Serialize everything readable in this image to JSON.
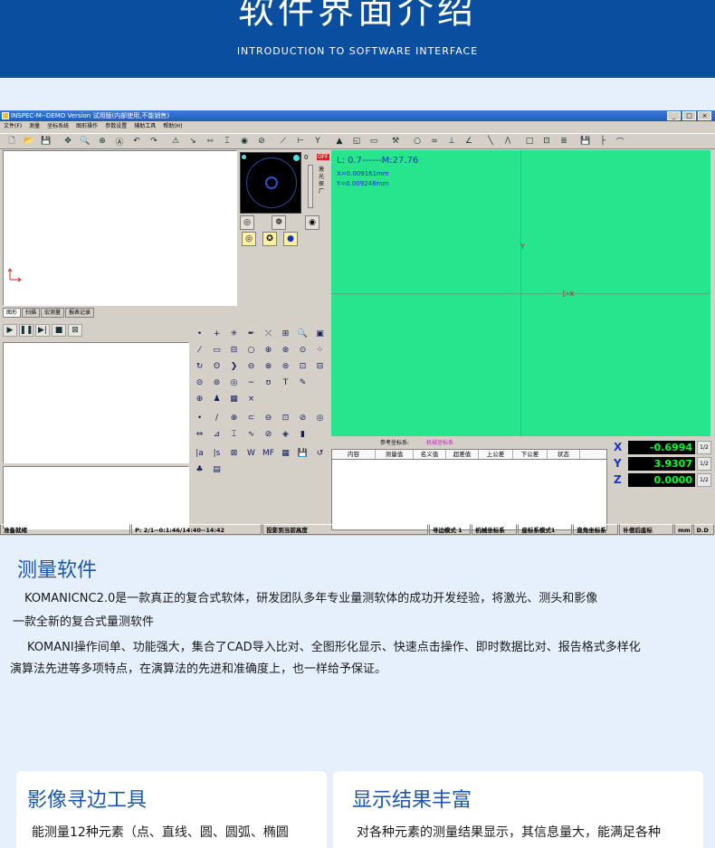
{
  "banner": {
    "title": "软件界面介绍",
    "subtitle": "INTRODUCTION TO SOFTWARE INTERFACE"
  },
  "window": {
    "title": "INSPEC-M--DEMO Version 试用版(内部使用,不能销售)",
    "controls": [
      "_",
      "□",
      "×"
    ],
    "menu": [
      "文件(F)",
      "测量",
      "坐标系统",
      "图形操作",
      "参数设置",
      "辅助工具",
      "帮助(H)"
    ]
  },
  "toolbar_icons": [
    "new-file-icon",
    "open-folder-icon",
    "save-icon",
    "sep",
    "move-icon",
    "zoom-window-icon",
    "zoom-fit-icon",
    "zoom-text-icon",
    "undo-icon",
    "redo-icon",
    "sep",
    "snap-icon",
    "measure-icon",
    "hdim-icon",
    "vdim-icon",
    "circle-dim-icon",
    "angle-dim-icon",
    "sep",
    "line-tool-icon",
    "width-icon",
    "y-tool-icon",
    "sep",
    "up-arrow-icon",
    "image-icon",
    "rect-icon",
    "sep",
    "tools-icon",
    "sep",
    "circle-icon",
    "equal-icon",
    "perp-icon",
    "angle-icon",
    "sep",
    "slash-icon",
    "lines-icon",
    "sep",
    "square-icon",
    "frame-icon",
    "list-icon",
    "sep",
    "save2-icon",
    "axis-icon",
    "arc-icon"
  ],
  "toolbar_glyphs": [
    "🗋",
    "📂",
    "💾",
    "",
    "✥",
    "🔍",
    "⊕",
    "Ⓐ",
    "↶",
    "↷",
    "",
    "⚠",
    "↘",
    "⇿",
    "⌶",
    "◉",
    "⊘",
    "",
    "⟋",
    "⊢",
    "Y",
    "",
    "▲",
    "◱",
    "▭",
    "",
    "⚒",
    "",
    "○",
    "=",
    "⊥",
    "∠",
    "",
    "╲",
    "/\\",
    "",
    "□",
    "⊡",
    "≣",
    "",
    "💾",
    "├",
    "⌒"
  ],
  "graph_tabs": [
    "图形",
    "扫描",
    "宏测量",
    "报表记录"
  ],
  "laser": {
    "zero": "0",
    "label": "激光探厂",
    "off": "OFF"
  },
  "control_icons": [
    "▶",
    "❚❚",
    "▶|",
    "■",
    "⊠"
  ],
  "tool_groups": [
    {
      "icons": [
        "•",
        "+",
        "✳",
        "✒",
        "⤫",
        "⊞",
        "🔍",
        "▣",
        "⁄",
        "▭",
        "⊟",
        "○",
        "⊕",
        "⊛",
        "⊙",
        "⁘",
        "↻",
        "ʘ",
        "❯",
        "⊖",
        "⊗",
        "⊜",
        "⊡",
        "⊟",
        "⊝",
        "⊚",
        "◎",
        "∼",
        "ʊ",
        "T",
        "✎",
        "",
        "⊕",
        "♟",
        "▦",
        "×"
      ]
    },
    {
      "icons": [
        "•",
        "/",
        "⊕",
        "⊂",
        "⊖",
        "⊡",
        "⊘",
        "◎",
        "⇔",
        "⊿",
        "⌶",
        "∿",
        "⊘",
        "◈",
        "▮"
      ]
    },
    {
      "icons": [
        "|a",
        "|s",
        "⊠",
        "W",
        "MF",
        "▦",
        "💾",
        "↺",
        "♣",
        "▤"
      ]
    }
  ],
  "view": {
    "length": "L: 0.7------M:27.76",
    "x": "X=0.009161mm",
    "y": "Y=0.009248mm",
    "y_axis": "Y",
    "cursor": "▷x"
  },
  "coordinate_system": {
    "label": "参考坐标系:",
    "value": "机械坐标系"
  },
  "table_headers": [
    "内容",
    "测量值",
    "名义值",
    "超差值",
    "上公差",
    "下公差",
    "状态"
  ],
  "dro": [
    {
      "axis": "X",
      "value": "-0.6994",
      "unit": "1/2"
    },
    {
      "axis": "Y",
      "value": "3.9307",
      "unit": "1/2"
    },
    {
      "axis": "Z",
      "value": "0.0000",
      "unit": "1/2"
    }
  ],
  "statusbar": [
    "准备就绪",
    "P: 2/1--0:1:46/14:40--14:42",
    "投影到当前高度",
    "寻边模式 1",
    "机械坐标系",
    "座标系模式1",
    "直角坐标系",
    "补偿后座标",
    "mm",
    "D.D"
  ],
  "section1": {
    "title": "测量软件",
    "p1": "KOMANICNC2.0是一款真正的复合式软体，研发团队多年专业量测软体的成功开发经验，将激光、测头和影像",
    "p1b": "一款全新的复合式量测软件",
    "p2": "KOMANI操作间单、功能强大，集合了CAD导入比对、全图形化显示、快速点击操作、即时数据比对、报告格式多样化",
    "p2b": "演算法先进等多项特点，在演算法的先进和准确度上，也一样给予保证。"
  },
  "cards": [
    {
      "title": "影像寻边工具",
      "text": "能测量12种元素（点、直线、圆、圆弧、椭圆"
    },
    {
      "title": "显示结果丰富",
      "text": "对各种元素的测量结果显示，其信息量大，能满足各种"
    }
  ],
  "colors": {
    "banner": "#0a4f9f",
    "view": "#27e58c",
    "heading": "#1c55b0",
    "background": "#e6f0fc"
  }
}
